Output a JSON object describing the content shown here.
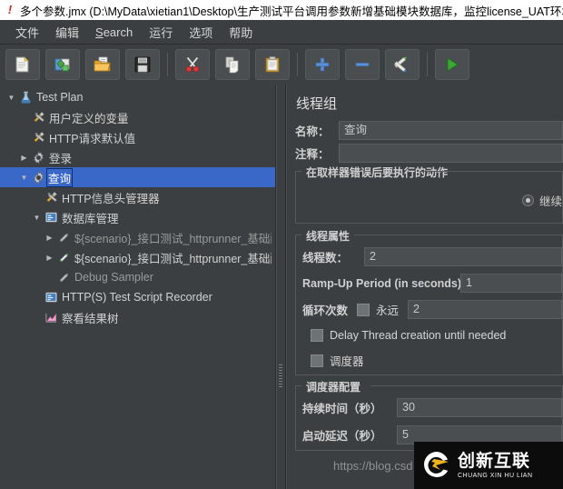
{
  "window": {
    "title": "多个参数.jmx (D:\\MyData\\xietian1\\Desktop\\生产测试平台调用参数新增基础模块数据库，监控license_UAT环境",
    "icon": "jmeter-alert-icon"
  },
  "menubar": {
    "items": [
      {
        "label": "文件",
        "name": "menu-file"
      },
      {
        "label": "编辑",
        "name": "menu-edit"
      },
      {
        "label": "Search",
        "name": "menu-search",
        "mnemonic": "S"
      },
      {
        "label": "运行",
        "name": "menu-run"
      },
      {
        "label": "选项",
        "name": "menu-options"
      },
      {
        "label": "帮助",
        "name": "menu-help"
      }
    ]
  },
  "toolbar": {
    "buttons": [
      {
        "name": "new-button",
        "icon": "new-document-icon",
        "tooltip": "新建"
      },
      {
        "name": "templates-button",
        "icon": "templates-icon",
        "tooltip": "模板"
      },
      {
        "name": "open-button",
        "icon": "open-folder-icon",
        "tooltip": "打开"
      },
      {
        "name": "save-button",
        "icon": "save-floppy-icon",
        "tooltip": "保存"
      },
      {
        "name": "cut-button",
        "icon": "scissors-icon",
        "tooltip": "剪切"
      },
      {
        "name": "copy-button",
        "icon": "copy-pages-icon",
        "tooltip": "复制"
      },
      {
        "name": "paste-button",
        "icon": "clipboard-icon",
        "tooltip": "粘贴"
      },
      {
        "name": "expand-all-button",
        "icon": "plus-icon",
        "tooltip": "展开全部"
      },
      {
        "name": "collapse-all-button",
        "icon": "minus-icon",
        "tooltip": "折叠全部"
      },
      {
        "name": "toggle-button",
        "icon": "toggle-pencils-icon",
        "tooltip": "启用/禁用"
      },
      {
        "name": "start-button",
        "icon": "green-play-icon",
        "tooltip": "启动"
      }
    ]
  },
  "tree": {
    "rows": [
      {
        "name": "tree-item-test-plan",
        "label": "Test Plan",
        "indent": 0,
        "toggle": "open",
        "icon": "flask-icon",
        "selected": false,
        "dim": false
      },
      {
        "name": "tree-item-user-defined-vars",
        "label": "用户定义的变量",
        "indent": 1,
        "toggle": "none",
        "icon": "tools-icon",
        "selected": false,
        "dim": false
      },
      {
        "name": "tree-item-http-defaults",
        "label": "HTTP请求默认值",
        "indent": 1,
        "toggle": "none",
        "icon": "tools-icon",
        "selected": false,
        "dim": false
      },
      {
        "name": "tree-item-login",
        "label": "登录",
        "indent": 1,
        "toggle": "closed",
        "icon": "gear-icon",
        "selected": false,
        "dim": false
      },
      {
        "name": "tree-item-query",
        "label": "查询",
        "indent": 1,
        "toggle": "open",
        "icon": "gear-icon",
        "selected": true,
        "dim": false
      },
      {
        "name": "tree-item-http-header-manager",
        "label": "HTTP信息头管理器",
        "indent": 2,
        "toggle": "none",
        "icon": "tools-icon",
        "selected": false,
        "dim": false
      },
      {
        "name": "tree-item-db-manage",
        "label": "数据库管理",
        "indent": 2,
        "toggle": "open",
        "icon": "recorder-icon",
        "selected": false,
        "dim": false
      },
      {
        "name": "tree-item-scenario-config-1",
        "label": "${scenario}_接口测试_httprunner_基础配置.",
        "indent": 3,
        "toggle": "closed",
        "icon": "pencil-gray-icon",
        "selected": false,
        "dim": true
      },
      {
        "name": "tree-item-scenario-config-2",
        "label": "${scenario}_接口测试_httprunner_基础配置.",
        "indent": 3,
        "toggle": "closed",
        "icon": "pencil-green-icon",
        "selected": false,
        "dim": false
      },
      {
        "name": "tree-item-debug-sampler",
        "label": "Debug Sampler",
        "indent": 3,
        "toggle": "none",
        "icon": "pencil-gray-icon",
        "selected": false,
        "dim": true
      },
      {
        "name": "tree-item-script-recorder",
        "label": "HTTP(S) Test Script Recorder",
        "indent": 2,
        "toggle": "none",
        "icon": "recorder-icon",
        "selected": false,
        "dim": false
      },
      {
        "name": "tree-item-view-results-tree",
        "label": "察看结果树",
        "indent": 2,
        "toggle": "none",
        "icon": "results-tree-icon",
        "selected": false,
        "dim": false
      }
    ]
  },
  "panel": {
    "title": "线程组",
    "name_label": "名称：",
    "name_value": "查询",
    "comment_label": "注释：",
    "comment_value": "",
    "error_action": {
      "legend": "在取样器错误后要执行的动作",
      "selected": "继续",
      "options": [
        "继续"
      ]
    },
    "thread_props": {
      "legend": "线程属性",
      "threads_label": "线程数：",
      "threads_value": "2",
      "rampup_label": "Ramp-Up Period (in seconds):",
      "rampup_value": "1",
      "loops_label": "循环次数",
      "forever_label": "永远",
      "forever_checked": false,
      "loops_value": "2",
      "delay_creation_label": "Delay Thread creation until needed",
      "delay_creation_checked": false,
      "scheduler_label": "调度器",
      "scheduler_checked": false
    },
    "scheduler_config": {
      "legend": "调度器配置",
      "duration_label": "持续时间（秒）",
      "duration_value": "30",
      "startup_delay_label": "启动延迟（秒）",
      "startup_delay_value": "5"
    }
  },
  "watermark": {
    "url": "https://blog.csd",
    "logo_cn": "创新互联",
    "logo_en": "CHUANG XIN HU LIAN",
    "logo_mark": "cx-logo-icon"
  },
  "colors": {
    "window_bg": "#3c3f41",
    "selection": "#3a68c8",
    "field_bg": "#4a4e50",
    "text": "#d2d2d2"
  }
}
